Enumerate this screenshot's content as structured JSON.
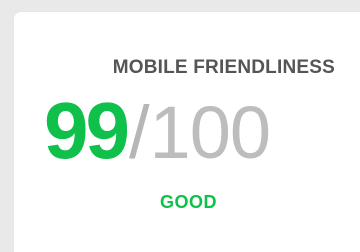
{
  "metric": {
    "title": "MOBILE FRIENDLINESS",
    "score": "99",
    "separator": "/",
    "max": "100",
    "rating": "GOOD",
    "score_value": 99,
    "max_value": 100
  },
  "colors": {
    "accent": "#0fc14a",
    "title": "#555555",
    "muted": "#bdbdbd",
    "background": "#e9e9e9",
    "card": "#ffffff"
  }
}
